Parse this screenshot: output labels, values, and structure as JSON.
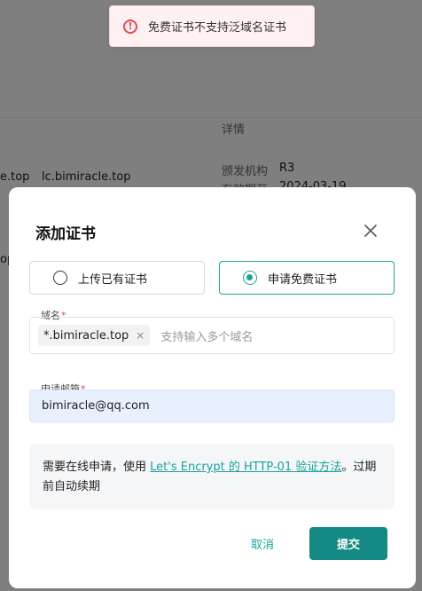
{
  "background": {
    "detail_header": "详情",
    "domain_partial": "e.top",
    "domain_full": "lc.bimiracle.top",
    "issuer_label": "颁发机构",
    "issuer_value": "R3",
    "expiry_label": "有效期至",
    "expiry_value": "2024-03-19",
    "left_fragment": "op"
  },
  "toast": {
    "icon": "error-circle-icon",
    "message": "免费证书不支持泛域名证书",
    "color": "#e5484d"
  },
  "dialog": {
    "title": "添加证书",
    "close_icon": "close-icon",
    "options": [
      {
        "label": "上传已有证书",
        "selected": false
      },
      {
        "label": "申请免费证书",
        "selected": true
      }
    ],
    "domain_field": {
      "label": "域名",
      "required_mark": "*",
      "tags": [
        "*.bimiracle.top"
      ],
      "tag_close": "×",
      "placeholder": "支持输入多个域名"
    },
    "email_field": {
      "label": "申请邮箱",
      "required_mark": "*",
      "value": "bimiracle@qq.com"
    },
    "info": {
      "prefix": "需要在线申请，使用 ",
      "link_text": "Let's Encrypt 的 HTTP-01 验证方法",
      "suffix": "。过期前自动续期"
    },
    "cancel_label": "取消",
    "submit_label": "提交"
  },
  "colors": {
    "accent": "#1aa39b",
    "submit_bg": "#138a84",
    "error": "#e5484d"
  }
}
